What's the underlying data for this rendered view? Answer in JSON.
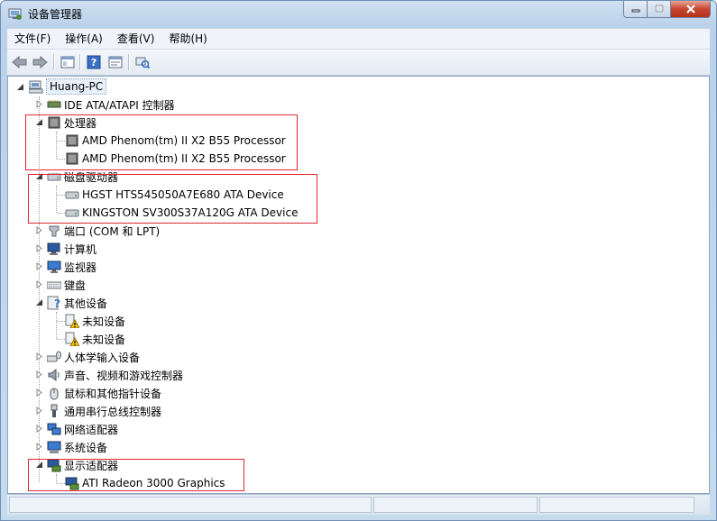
{
  "window": {
    "title": "设备管理器"
  },
  "menu": [
    "文件(F)",
    "操作(A)",
    "查看(V)",
    "帮助(H)"
  ],
  "tree": {
    "root": "Huang-PC",
    "nodes": [
      {
        "label": "IDE ATA/ATAPI 控制器",
        "icon": "ide-controller-icon",
        "expanded": false
      },
      {
        "label": "处理器",
        "icon": "processor-icon",
        "expanded": true,
        "children": [
          {
            "label": "AMD Phenom(tm) II X2 B55 Processor",
            "icon": "processor-icon"
          },
          {
            "label": "AMD Phenom(tm) II X2 B55 Processor",
            "icon": "processor-icon"
          }
        ]
      },
      {
        "label": "磁盘驱动器",
        "icon": "disk-drive-icon",
        "expanded": true,
        "children": [
          {
            "label": "HGST HTS545050A7E680 ATA Device",
            "icon": "disk-drive-icon"
          },
          {
            "label": "KINGSTON SV300S37A120G ATA Device",
            "icon": "disk-drive-icon"
          }
        ]
      },
      {
        "label": "端口 (COM 和 LPT)",
        "icon": "port-icon",
        "expanded": false
      },
      {
        "label": "计算机",
        "icon": "computer-icon",
        "expanded": false
      },
      {
        "label": "监视器",
        "icon": "monitor-icon",
        "expanded": false
      },
      {
        "label": "键盘",
        "icon": "keyboard-icon",
        "expanded": false
      },
      {
        "label": "其他设备",
        "icon": "other-devices-icon",
        "expanded": true,
        "children": [
          {
            "label": "未知设备",
            "icon": "unknown-device-warning-icon"
          },
          {
            "label": "未知设备",
            "icon": "unknown-device-warning-icon"
          }
        ]
      },
      {
        "label": "人体学输入设备",
        "icon": "hid-icon",
        "expanded": false
      },
      {
        "label": "声音、视频和游戏控制器",
        "icon": "sound-icon",
        "expanded": false
      },
      {
        "label": "鼠标和其他指针设备",
        "icon": "mouse-icon",
        "expanded": false
      },
      {
        "label": "通用串行总线控制器",
        "icon": "usb-icon",
        "expanded": false
      },
      {
        "label": "网络适配器",
        "icon": "network-adapter-icon",
        "expanded": false
      },
      {
        "label": "系统设备",
        "icon": "system-devices-icon",
        "expanded": false
      },
      {
        "label": "显示适配器",
        "icon": "display-adapter-icon",
        "expanded": true,
        "children": [
          {
            "label": "ATI Radeon 3000 Graphics",
            "icon": "display-adapter-icon"
          }
        ]
      }
    ]
  },
  "colors": {
    "highlight_box": "#e0262e",
    "titlebar": "#c7dbef",
    "close_button": "#c7462f"
  }
}
